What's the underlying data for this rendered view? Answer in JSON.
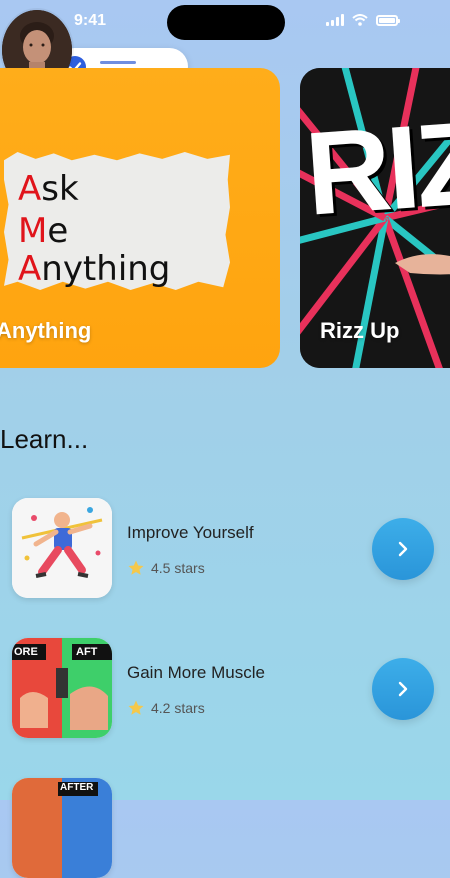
{
  "status_bar": {
    "time": "9:41"
  },
  "cards": [
    {
      "label": "Anything",
      "art_lines": [
        "Ask",
        "Me",
        "Anything"
      ]
    },
    {
      "label": "Rizz Up",
      "art_text": "RIZ"
    }
  ],
  "section": {
    "title": "Learn..."
  },
  "courses": [
    {
      "title": "Improve Yourself",
      "rating": "4.5 stars",
      "thumb_tags": []
    },
    {
      "title": "Gain More Muscle",
      "rating": "4.2 stars",
      "thumb_tags": [
        "ORE",
        "AFT"
      ]
    },
    {
      "title": "",
      "rating": "",
      "thumb_tags": [
        "AFTER"
      ]
    }
  ],
  "colors": {
    "accent": "#2f5fde",
    "card_orange": "#ffa40f",
    "button_blue": "#3aa7e6",
    "star": "#f5c84b"
  },
  "icons": [
    "check-icon",
    "star-icon",
    "chevron-right-icon",
    "signal-icon",
    "wifi-icon",
    "battery-icon"
  ]
}
